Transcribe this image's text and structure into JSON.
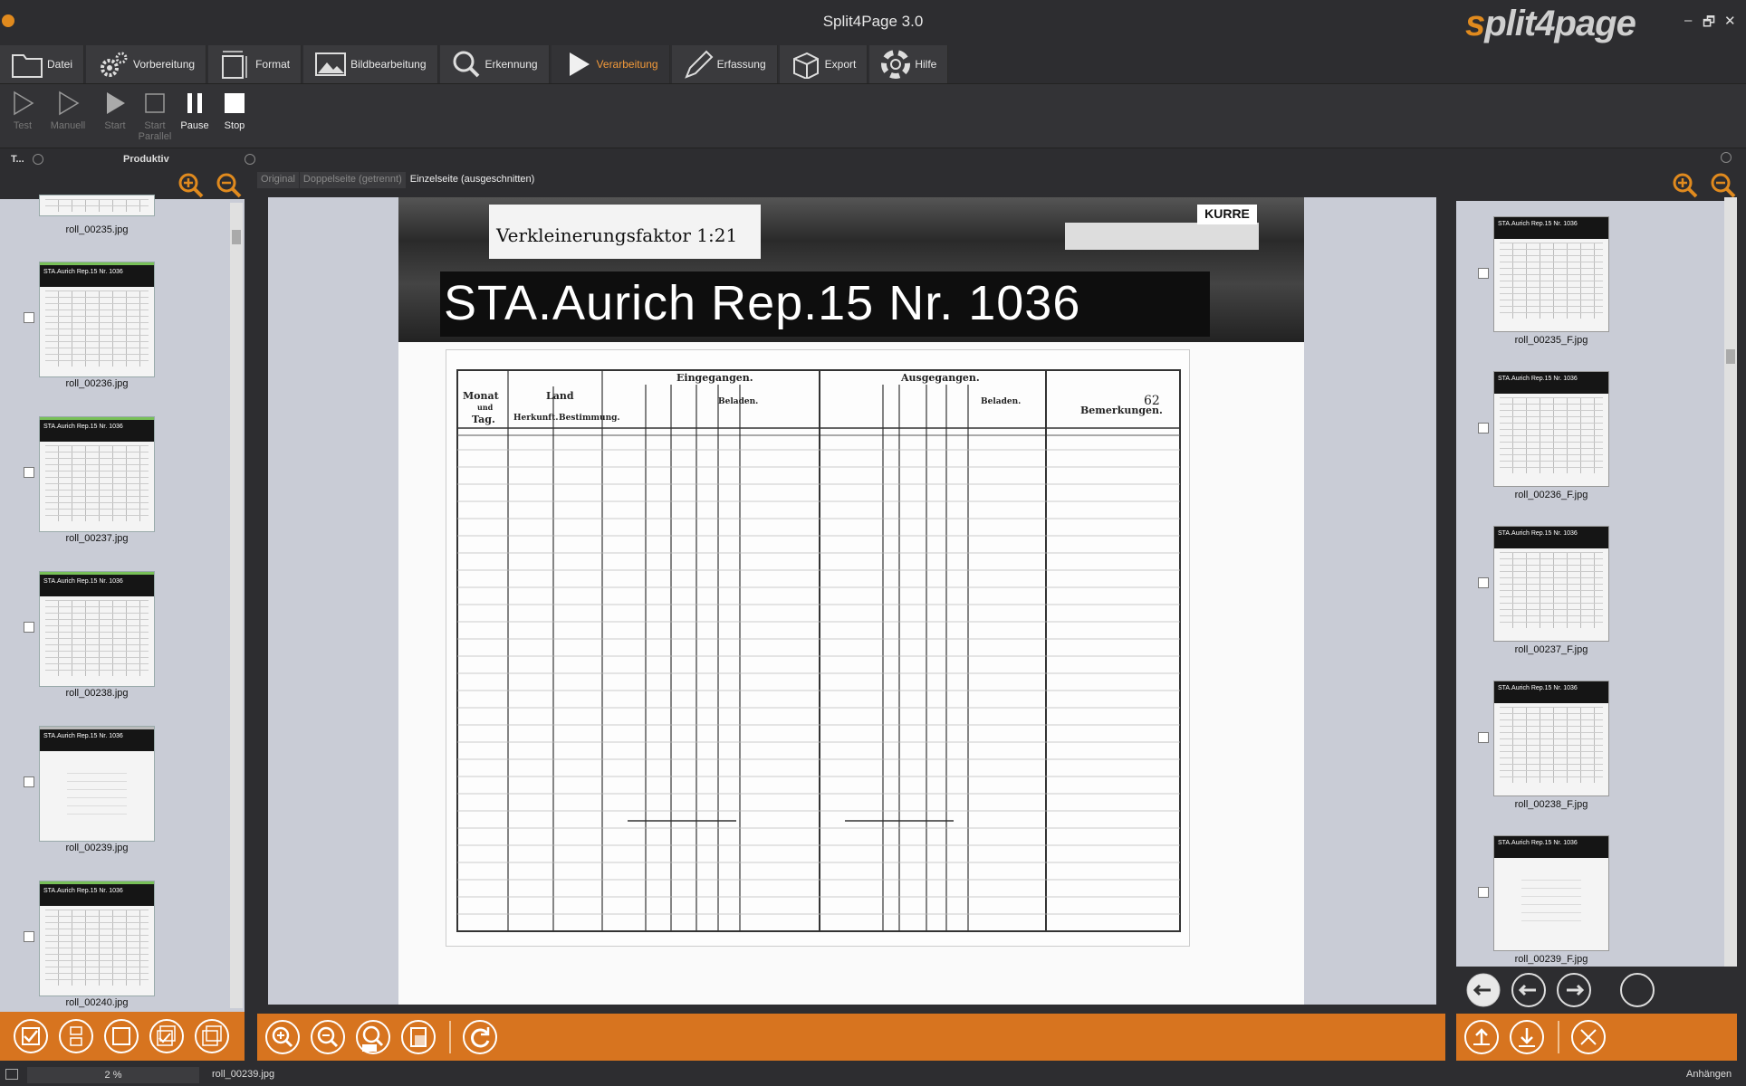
{
  "window": {
    "title": "Split4Page 3.0",
    "logo_part1": "s",
    "logo_part2": "plit4page"
  },
  "tabs": [
    {
      "label": "Datei"
    },
    {
      "label": "Vorbereitung"
    },
    {
      "label": "Format"
    },
    {
      "label": "Bildbearbeitung"
    },
    {
      "label": "Erkennung"
    },
    {
      "label": "Verarbeitung"
    },
    {
      "label": "Erfassung"
    },
    {
      "label": "Export"
    },
    {
      "label": "Hilfe"
    }
  ],
  "active_tab": "Verarbeitung",
  "ribbon": {
    "test": "Test",
    "manuell": "Manuell",
    "start": "Start",
    "start_parallel": "Start Parallel",
    "pause": "Pause",
    "stop": "Stop"
  },
  "panel_headers": {
    "left_short": "T...",
    "left_title": "Produktiv"
  },
  "view_tabs": [
    "Original",
    "Doppelseite (getrennt)",
    "Einzelseite (ausgeschnitten)"
  ],
  "document": {
    "label_factor": "Verkleinerungsfaktor   1:21",
    "label_archive": "STA.Aurich Rep.15  Nr.  1036",
    "label_kurre": "KURRE",
    "page_number": "62",
    "col_monat": "Monat",
    "col_und": "und",
    "col_tag": "Tag.",
    "col_land": "Land",
    "col_herkunft": "Herkunft.",
    "col_bestimmung": "Bestimmung.",
    "col_eingegangen": "Eingegangen.",
    "col_ausgegangen": "Ausgegangen.",
    "col_beladen1": "Beladen.",
    "col_beladen2": "Beladen.",
    "col_bemerkungen": "Bemerkungen."
  },
  "left_thumbs": [
    {
      "label": "roll_00235.jpg"
    },
    {
      "label": "roll_00236.jpg"
    },
    {
      "label": "roll_00237.jpg"
    },
    {
      "label": "roll_00238.jpg"
    },
    {
      "label": "roll_00239.jpg"
    },
    {
      "label": "roll_00240.jpg"
    }
  ],
  "right_thumbs": [
    {
      "label": "roll_00235_F.jpg"
    },
    {
      "label": "roll_00236_F.jpg"
    },
    {
      "label": "roll_00237_F.jpg"
    },
    {
      "label": "roll_00238_F.jpg"
    },
    {
      "label": "roll_00239_F.jpg"
    }
  ],
  "thumb_header_text": "STA.Aurich Rep.15  Nr.  1036",
  "status": {
    "zoom": "2 %",
    "file": "roll_00239.jpg",
    "right": "Anhängen"
  },
  "colors": {
    "accent": "#d7741f",
    "active_tab": "#f39a3a",
    "panel_bg": "#c9ccd6"
  }
}
